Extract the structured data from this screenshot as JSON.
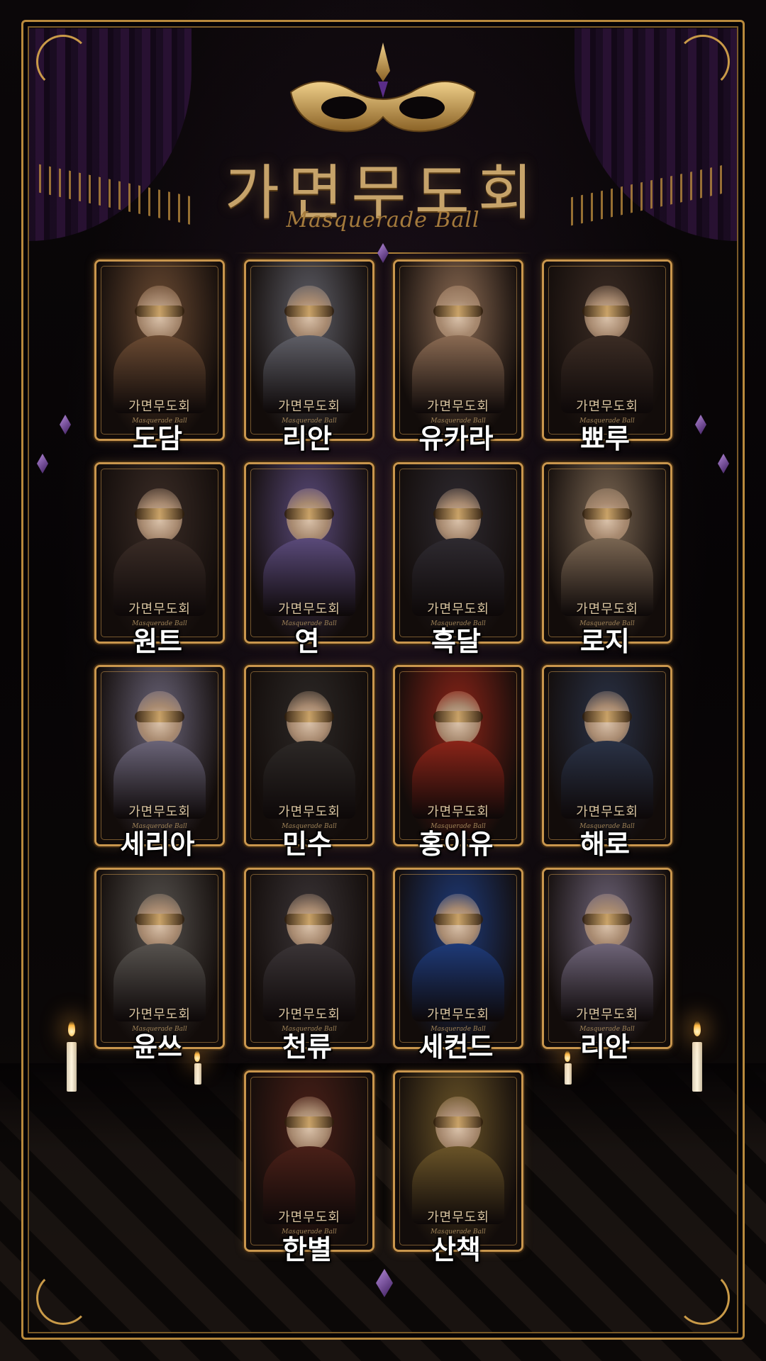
{
  "header": {
    "title": "가면무도회",
    "subtitle": "Masquerade Ball"
  },
  "card_common": {
    "title": "가면무도회",
    "subtitle": "Masquerade Ball"
  },
  "characters": [
    {
      "name": "도담",
      "tone": "#6a4a32"
    },
    {
      "name": "리안",
      "tone": "#5e5e66"
    },
    {
      "name": "유카라",
      "tone": "#8a6a52"
    },
    {
      "name": "뾰루",
      "tone": "#3b2c24"
    },
    {
      "name": "원트",
      "tone": "#3a2c26"
    },
    {
      "name": "연",
      "tone": "#5a4a7a"
    },
    {
      "name": "흑달",
      "tone": "#2e2a30"
    },
    {
      "name": "로지",
      "tone": "#7a6652"
    },
    {
      "name": "세리아",
      "tone": "#6a6478"
    },
    {
      "name": "민수",
      "tone": "#2c2826"
    },
    {
      "name": "홍이유",
      "tone": "#8a2418"
    },
    {
      "name": "해로",
      "tone": "#2a3246"
    },
    {
      "name": "윤쓰",
      "tone": "#56524e"
    },
    {
      "name": "천류",
      "tone": "#3a3436"
    },
    {
      "name": "세컨드",
      "tone": "#1e3a78"
    },
    {
      "name": "리안",
      "tone": "#6e6478"
    },
    {
      "name": "한별",
      "tone": "#4a2018"
    },
    {
      "name": "산책",
      "tone": "#6a5428"
    }
  ],
  "colors": {
    "gold": "#c9964d",
    "purple": "#3b1a5c",
    "background": "#050306"
  }
}
